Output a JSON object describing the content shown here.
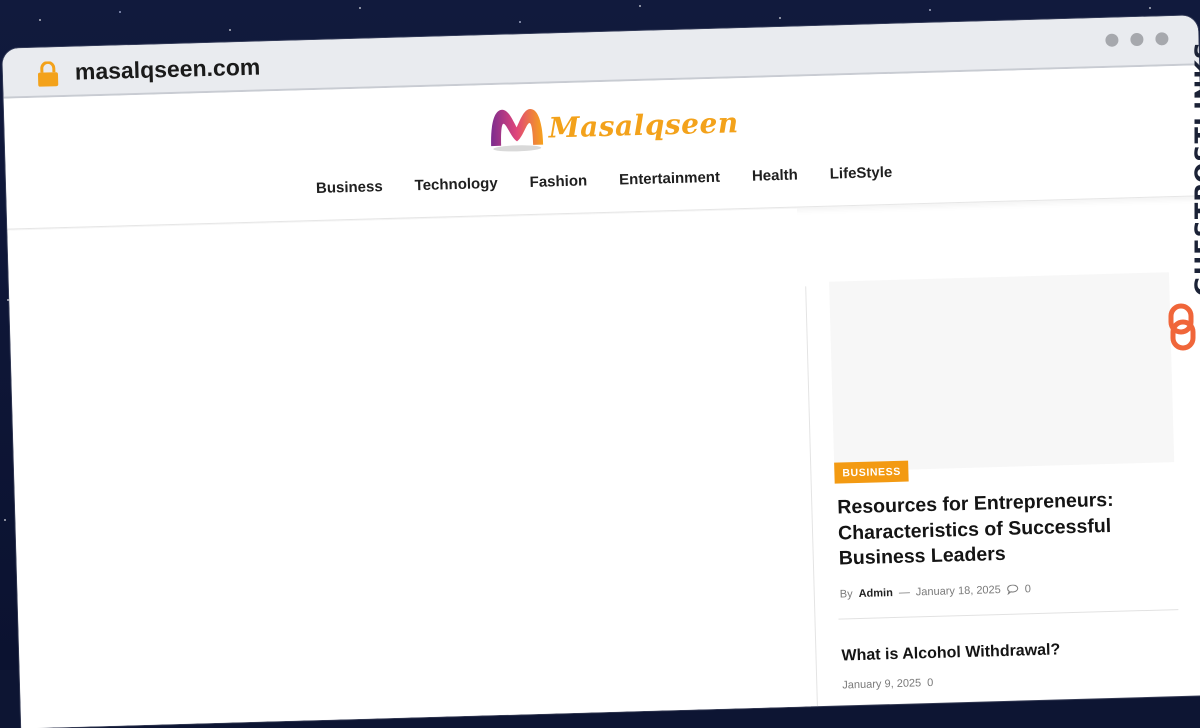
{
  "browser": {
    "url": "masalqseen.com",
    "accent": "#f39a12"
  },
  "site": {
    "logo_text": "Masalqseen",
    "nav": [
      "Business",
      "Technology",
      "Fashion",
      "Entertainment",
      "Health",
      "LifeStyle"
    ]
  },
  "sidebar": {
    "featured": {
      "category": "BUSINESS",
      "title": "Resources for Entrepreneurs: Characteristics of Successful Business Leaders",
      "by": "By",
      "author": "Admin",
      "dash": "—",
      "date": "January 18, 2025",
      "comments": "0"
    },
    "second": {
      "title": "What is Alcohol Withdrawal?",
      "date": "January 9, 2025",
      "comments": "0"
    }
  },
  "watermark": {
    "text": "GUESTPOSTLINKS"
  }
}
